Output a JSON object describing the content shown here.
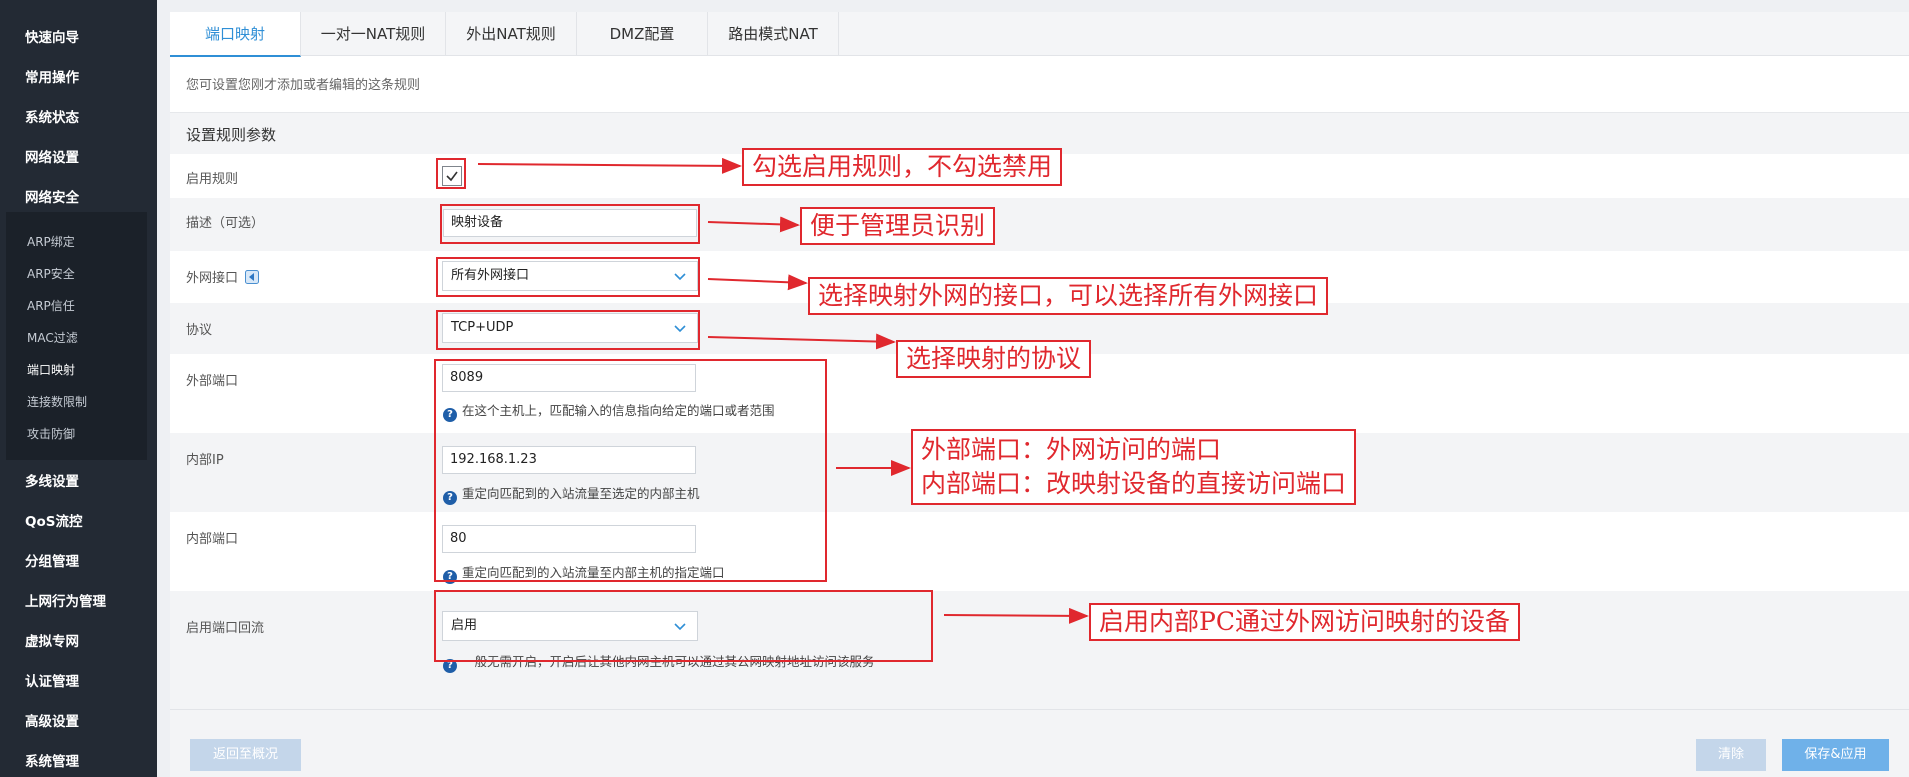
{
  "sidebar": {
    "items": [
      {
        "label": "快速向导"
      },
      {
        "label": "常用操作"
      },
      {
        "label": "系统状态"
      },
      {
        "label": "网络设置"
      },
      {
        "label": "网络安全"
      }
    ],
    "subitems": [
      {
        "label": "ARP绑定"
      },
      {
        "label": "ARP安全"
      },
      {
        "label": "ARP信任"
      },
      {
        "label": "MAC过滤"
      },
      {
        "label": "端口映射"
      },
      {
        "label": "连接数限制"
      },
      {
        "label": "攻击防御"
      }
    ],
    "items2": [
      {
        "label": "多线设置"
      },
      {
        "label": "QoS流控"
      },
      {
        "label": "分组管理"
      },
      {
        "label": "上网行为管理"
      },
      {
        "label": "虚拟专网"
      },
      {
        "label": "认证管理"
      },
      {
        "label": "高级设置"
      },
      {
        "label": "系统管理"
      }
    ]
  },
  "tabs": [
    {
      "label": "端口映射"
    },
    {
      "label": "一对一NAT规则"
    },
    {
      "label": "外出NAT规则"
    },
    {
      "label": "DMZ配置"
    },
    {
      "label": "路由模式NAT"
    }
  ],
  "description": "您可设置您刚才添加或者编辑的这条规则",
  "section_title": "设置规则参数",
  "form": {
    "enable_label": "启用规则",
    "desc_label": "描述（可选）",
    "desc_value": "映射设备",
    "wan_label": "外网接口",
    "wan_value": "所有外网接口",
    "proto_label": "协议",
    "proto_value": "TCP+UDP",
    "ext_port_label": "外部端口",
    "ext_port_value": "8089",
    "ext_port_hint": "在这个主机上，匹配输入的信息指向给定的端口或者范围",
    "int_ip_label": "内部IP",
    "int_ip_value": "192.168.1.23",
    "int_ip_hint": "重定向匹配到的入站流量至选定的内部主机",
    "int_port_label": "内部端口",
    "int_port_value": "80",
    "int_port_hint": "重定向匹配到的入站流量至内部主机的指定端口",
    "loopback_label": "启用端口回流",
    "loopback_value": "启用",
    "loopback_hint": "一般无需开启，开启后让其他内网主机可以通过其公网映射地址访问该服务"
  },
  "annotations": {
    "enable": "勾选启用规则，不勾选禁用",
    "desc": "便于管理员识别",
    "wan": "选择映射外网的接口，可以选择所有外网接口",
    "proto": "选择映射的协议",
    "ports_line1": "外部端口：外网访问的端口",
    "ports_line2": "内部端口：改映射设备的直接访问端口",
    "loopback": "启用内部PC通过外网访问映射的设备"
  },
  "footer": {
    "back": "返回至概况",
    "clear": "清除",
    "save": "保存&应用"
  },
  "colors": {
    "accent": "#2f8fd6",
    "annotation": "#e0282e",
    "sidebar": "#232a34"
  }
}
